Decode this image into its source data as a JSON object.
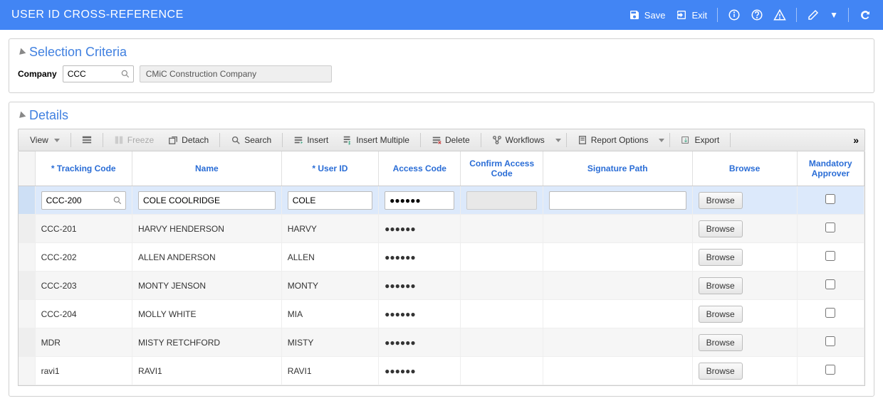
{
  "header": {
    "title": "USER ID CROSS-REFERENCE",
    "save_label": "Save",
    "exit_label": "Exit"
  },
  "criteria": {
    "section_title": "Selection Criteria",
    "company_label": "Company",
    "company_value": "CCC",
    "company_name": "CMiC Construction Company"
  },
  "details": {
    "section_title": "Details",
    "toolbar": {
      "view": "View",
      "freeze": "Freeze",
      "detach": "Detach",
      "search": "Search",
      "insert": "Insert",
      "insert_multiple": "Insert Multiple",
      "delete": "Delete",
      "workflows": "Workflows",
      "report_options": "Report Options",
      "export": "Export"
    },
    "columns": {
      "tracking_code": "* Tracking Code",
      "name": "Name",
      "user_id": "* User ID",
      "access_code": "Access Code",
      "confirm_access": "Confirm Access Code",
      "signature_path": "Signature Path",
      "browse": "Browse",
      "mandatory_approver": "Mandatory Approver"
    },
    "browse_button": "Browse",
    "rows": [
      {
        "tracking": "CCC-200",
        "name": "COLE COOLRIDGE",
        "user_id": "COLE",
        "access": "●●●●●●",
        "signature": "",
        "selected": true
      },
      {
        "tracking": "CCC-201",
        "name": "HARVY HENDERSON",
        "user_id": "HARVY",
        "access": "●●●●●●",
        "signature": ""
      },
      {
        "tracking": "CCC-202",
        "name": "ALLEN ANDERSON",
        "user_id": "ALLEN",
        "access": "●●●●●●",
        "signature": ""
      },
      {
        "tracking": "CCC-203",
        "name": "MONTY JENSON",
        "user_id": "MONTY",
        "access": "●●●●●●",
        "signature": ""
      },
      {
        "tracking": "CCC-204",
        "name": "MOLLY WHITE",
        "user_id": "MIA",
        "access": "●●●●●●",
        "signature": ""
      },
      {
        "tracking": "MDR",
        "name": "MISTY RETCHFORD",
        "user_id": "MISTY",
        "access": "●●●●●●",
        "signature": ""
      },
      {
        "tracking": "ravi1",
        "name": "RAVI1",
        "user_id": "RAVI1",
        "access": "●●●●●●",
        "signature": ""
      }
    ]
  }
}
